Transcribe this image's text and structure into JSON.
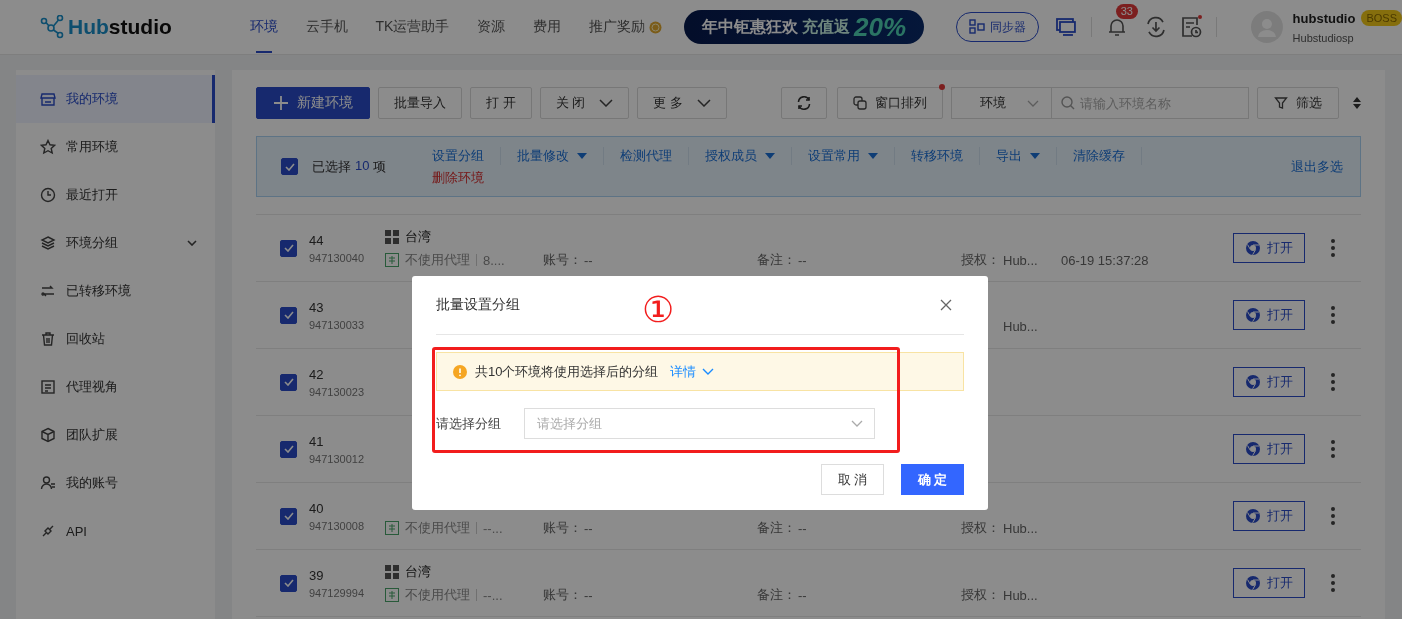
{
  "header": {
    "logo": "Hubstudio",
    "nav": [
      {
        "label": "环境",
        "selected": true
      },
      {
        "label": "云手机",
        "selected": false
      },
      {
        "label": "TK运营助手",
        "selected": false
      },
      {
        "label": "资源",
        "selected": false
      },
      {
        "label": "费用",
        "selected": false
      },
      {
        "label": "推广奖励",
        "selected": false,
        "coin": true
      }
    ],
    "banner": {
      "text": "年中钜惠狂欢",
      "highlight": "充值返",
      "percent": "20%"
    },
    "sync_button": "同步器",
    "notification_count": "33",
    "user": {
      "name": "hubstudio",
      "badge": "BOSS",
      "account": "Hubstudiosp"
    }
  },
  "sidebar": {
    "items": [
      {
        "label": "我的环境",
        "selected": true
      },
      {
        "label": "常用环境",
        "selected": false
      },
      {
        "label": "最近打开",
        "selected": false
      },
      {
        "label": "环境分组",
        "selected": false,
        "expandable": true
      },
      {
        "label": "已转移环境",
        "selected": false
      },
      {
        "label": "回收站",
        "selected": false
      },
      {
        "label": "代理视角",
        "selected": false
      },
      {
        "label": "团队扩展",
        "selected": false
      },
      {
        "label": "我的账号",
        "selected": false
      },
      {
        "label": "API",
        "selected": false
      }
    ]
  },
  "toolbar": {
    "buttons": [
      {
        "label": "新建环境",
        "kind": "primary"
      },
      {
        "label": "批量导入",
        "kind": "plain"
      },
      {
        "label": "打 开",
        "kind": "plain"
      },
      {
        "label": "关 闭",
        "kind": "dropdown"
      },
      {
        "label": "更 多",
        "kind": "dropdown"
      }
    ],
    "arrange_button": "窗口排列",
    "scope_select": "环境",
    "search": {
      "placeholder": "请输入环境名称"
    },
    "filter_button": "筛选"
  },
  "selection_bar": {
    "checked": true,
    "label": "已选择",
    "count": "10",
    "unit": "项",
    "actions": [
      {
        "label": "设置分组",
        "kind": "link"
      },
      {
        "label": "批量修改",
        "kind": "menu"
      },
      {
        "label": "检测代理",
        "kind": "link"
      },
      {
        "label": "授权成员",
        "kind": "menu"
      },
      {
        "label": "设置常用",
        "kind": "menu"
      },
      {
        "label": "转移环境",
        "kind": "link"
      },
      {
        "label": "导出",
        "kind": "menu"
      },
      {
        "label": "清除缓存",
        "kind": "link"
      },
      {
        "label": "删除环境",
        "kind": "danger"
      }
    ],
    "exit": "退出多选"
  },
  "table": {
    "rows": [
      {
        "checked": true,
        "id": "44",
        "serial": "947130040",
        "name": "台湾",
        "proxy": "不使用代理",
        "ip": "8....",
        "account_label": "账号：",
        "account": "--",
        "note_label": "备注：",
        "note": "--",
        "auth_label": "授权：",
        "auth": "Hub...",
        "time": "06-19 15:37:28",
        "open": "打开"
      },
      {
        "checked": true,
        "id": "43",
        "serial": "947130033",
        "auth": "Hub...",
        "open": "打开"
      },
      {
        "checked": true,
        "id": "42",
        "serial": "947130023",
        "open": "打开"
      },
      {
        "checked": true,
        "id": "41",
        "serial": "947130012",
        "open": "打开"
      },
      {
        "checked": true,
        "id": "40",
        "serial": "947130008",
        "proxy": "不使用代理",
        "ip": "--...",
        "account_label": "账号：",
        "account": "--",
        "note_label": "备注：",
        "note": "--",
        "auth_label": "授权：",
        "auth": "Hub...",
        "open": "打开"
      },
      {
        "checked": true,
        "id": "39",
        "serial": "947129994",
        "name": "台湾",
        "proxy": "不使用代理",
        "ip": "--...",
        "account_label": "账号：",
        "account": "--",
        "note_label": "备注：",
        "note": "--",
        "auth_label": "授权：",
        "auth": "Hub...",
        "open": "打开"
      }
    ]
  },
  "dialog": {
    "title": "批量设置分组",
    "alert": "共10个环境将使用选择后的分组",
    "alert_link": "详情",
    "field_label": "请选择分组",
    "select": {
      "placeholder": "请选择分组"
    },
    "cancel": "取 消",
    "confirm": "确 定"
  },
  "annotation": {
    "marker": "①"
  }
}
